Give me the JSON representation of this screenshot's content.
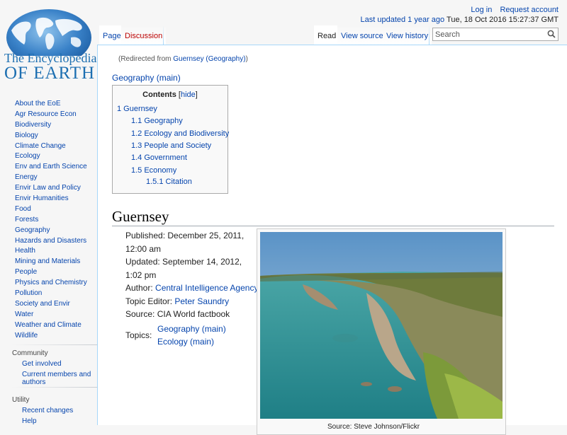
{
  "header": {
    "login": "Log in",
    "request_account": "Request account",
    "last_updated_link": "Last updated 1 year ago",
    "last_updated_date": "Tue, 18 Oct 2016 15:27:37 GMT"
  },
  "logo": {
    "line1": "The Encyclopedia",
    "line2": "OF EARTH"
  },
  "tabs": {
    "page": "Page",
    "discussion": "Discussion",
    "read": "Read",
    "view_source": "View source",
    "view_history": "View history"
  },
  "search": {
    "placeholder": "Search"
  },
  "sidebar": {
    "items": [
      "About the EoE",
      "Agr Resource Econ",
      "Biodiversity",
      "Biology",
      "Climate Change",
      "Ecology",
      "Env and Earth Science",
      "Energy",
      "Envir Law and Policy",
      "Envir Humanities",
      "Food",
      "Forests",
      "Geography",
      "Hazards and Disasters",
      "Health",
      "Mining and Materials",
      "People",
      "Physics and Chemistry",
      "Pollution",
      "Society and Envir",
      "Water",
      "Weather and Climate",
      "Wildlife"
    ],
    "community_heading": "Community",
    "community_items": [
      "Get involved",
      "Current members and authors"
    ],
    "utility_heading": "Utility",
    "utility_items": [
      "Recent changes",
      "Help"
    ]
  },
  "content": {
    "redirect_prefix": "(Redirected from ",
    "redirect_link": "Guernsey (Geography)",
    "redirect_suffix": ")",
    "geo_main": "Geography (main)",
    "toc": {
      "title": "Contents",
      "hide_open": "[",
      "hide": "hide",
      "hide_close": "]",
      "entries": [
        "1 Guernsey",
        "1.1 Geography",
        "1.2 Ecology and Biodiversity",
        "1.3 People and Society",
        "1.4 Government",
        "1.5 Economy",
        "1.5.1 Citation"
      ]
    },
    "heading": "Guernsey",
    "meta": {
      "published": "Published: December 25, 2011, 12:00 am",
      "updated": "Updated: September 14, 2012, 1:02 pm",
      "author_label": "Author: ",
      "author": "Central Intelligence Agency",
      "topic_editor_label": "Topic Editor: ",
      "topic_editor": "Peter Saundry",
      "source": "Source: CIA World factbook",
      "topics_label": "Topics:",
      "topics": [
        "Geography (main)",
        "Ecology (main)"
      ]
    },
    "photo_caption": "Source: Steve Johnson/Flickr"
  }
}
